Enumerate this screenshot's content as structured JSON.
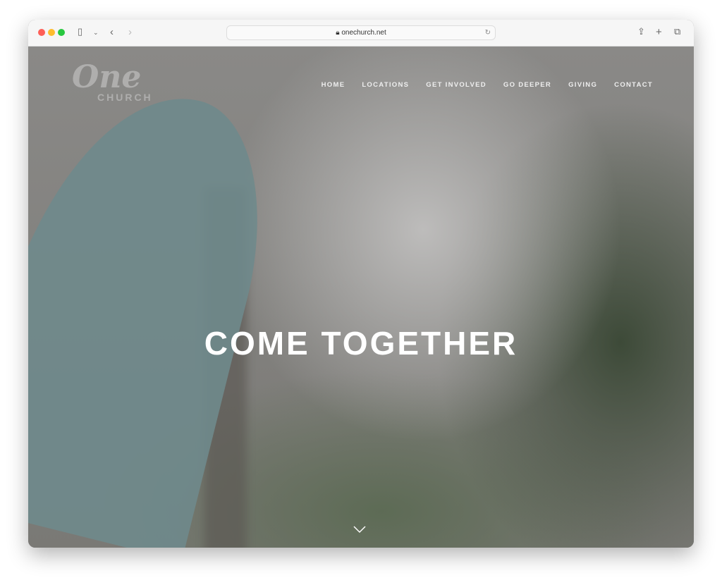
{
  "browser": {
    "url": "onechurch.net"
  },
  "site": {
    "logo_top": "One",
    "logo_bottom": "CHURCH",
    "nav": [
      "HOME",
      "LOCATIONS",
      "GET INVOLVED",
      "GO DEEPER",
      "GIVING",
      "CONTACT"
    ],
    "hero_title": "COME TOGETHER"
  }
}
